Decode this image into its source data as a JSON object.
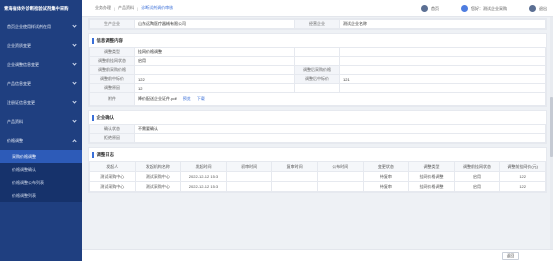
{
  "brand": "青海省体外诊断检验试剂集中采购",
  "breadcrumb": [
    "业务办理",
    "产品资料",
    "诊断试剂调价审核"
  ],
  "top_right": {
    "home": "首页",
    "user": "您好：测试企业采购",
    "logout": "退出"
  },
  "sidebar": {
    "items": [
      {
        "label": "首页企业使用样试剂在用"
      },
      {
        "label": "企业资质变更"
      },
      {
        "label": "企业调整信息变更"
      },
      {
        "label": "产品信息变更"
      },
      {
        "label": "注册证信息变更"
      },
      {
        "label": "产品资料"
      },
      {
        "label": "价格调整"
      }
    ],
    "subitems": [
      {
        "label": "采购价格调整",
        "active": true
      },
      {
        "label": "价格调整确认",
        "active": false
      },
      {
        "label": "价格调整公布列表",
        "active": false
      },
      {
        "label": "价格调整列表",
        "active": false
      }
    ]
  },
  "top_row": {
    "label1": "生产企业",
    "value1": "山东远陶医疗器械有限公司",
    "label2": "经营企业",
    "value2": "测试企业名称"
  },
  "section1": {
    "title": "信息调整内容",
    "rows": {
      "adjust_type_label": "调整类型",
      "adjust_type_value": "挂网价格调整",
      "adjust_before_label": "调整前挂网状态",
      "adjust_before_value": "启用",
      "before_price_label": "调整前采购价格",
      "before_price_value": "",
      "after_price_label": "调整后采购价格",
      "after_price_value": "",
      "before_limit_label": "调整前中标价",
      "before_limit_value": "122",
      "after_limit_label": "调整后中标价",
      "after_limit_value": "121",
      "reason_label": "调整原因",
      "reason_value": "12",
      "attach_label": "附件",
      "attach_file": "降价配送企业证件.pdf",
      "attach_preview": "预览",
      "attach_download": "下载"
    }
  },
  "section2": {
    "title": "企业确认",
    "confirm_label": "确认状态",
    "confirm_value": "不需要确认",
    "opinion_label": "拒绝原因",
    "opinion_value": ""
  },
  "section3": {
    "title": "调整日志",
    "headers": [
      "发起人",
      "发起机构名称",
      "发起时间",
      "初审时间",
      "复审时间",
      "公布时间",
      "变更状态",
      "调整类型",
      "调整前挂网状态",
      "调整前挂网价(元)"
    ],
    "rows": [
      [
        "测试采购中心",
        "测试采购中心",
        "2022-12-12 15:3",
        "",
        "",
        "",
        "待复审",
        "挂网价格调整",
        "启用",
        "122"
      ],
      [
        "测试采购中心",
        "测试采购中心",
        "2022-12-12 15:3",
        "",
        "",
        "",
        "待复审",
        "挂网价格调整",
        "启用",
        "122"
      ]
    ]
  },
  "footer": {
    "back": "返回"
  }
}
